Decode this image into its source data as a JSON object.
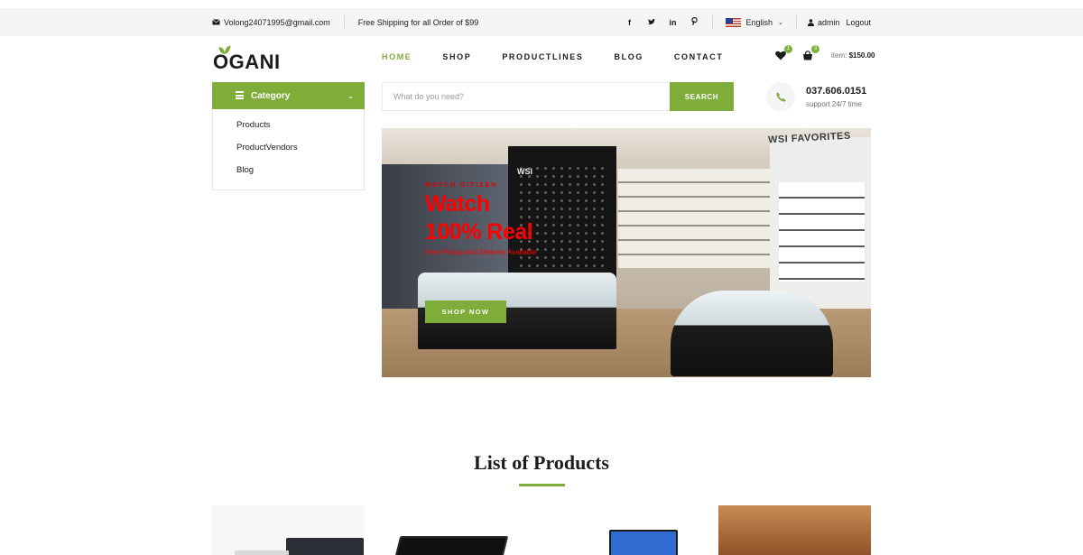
{
  "topbar": {
    "email": "Volong24071995@gmail.com",
    "shipping": "Free Shipping for all Order of $99",
    "social": [
      "facebook-icon",
      "twitter-icon",
      "linkedin-icon",
      "pinterest-icon"
    ],
    "language": "English",
    "user": "admin",
    "logout": "Logout"
  },
  "header": {
    "logo": "OGANI",
    "nav": [
      "HOME",
      "SHOP",
      "PRODUCTLINES",
      "BLOG",
      "CONTACT"
    ],
    "wishlist_count": "1",
    "cart_count": "3",
    "cart_label": "item:",
    "cart_total": "$150.00"
  },
  "category": {
    "title": "Category",
    "items": [
      "Products",
      "ProductVendors",
      "Blog"
    ]
  },
  "search": {
    "placeholder": "What do you need?",
    "button": "SEARCH"
  },
  "contact": {
    "phone": "037.606.0151",
    "support": "support 24/7 time"
  },
  "hero": {
    "subtitle": "WATCH CITIZEN",
    "title_line1": "Watch",
    "title_line2": "100% Real",
    "description": "Free Pickup and Delivery Available",
    "button": "SHOP NOW",
    "store_sign": "WSI",
    "store_sign2": "WSI FAVORITES"
  },
  "products_section": {
    "title": "List of Products"
  },
  "colors": {
    "accent": "#7fad39",
    "hero_text": "#ff0000"
  }
}
